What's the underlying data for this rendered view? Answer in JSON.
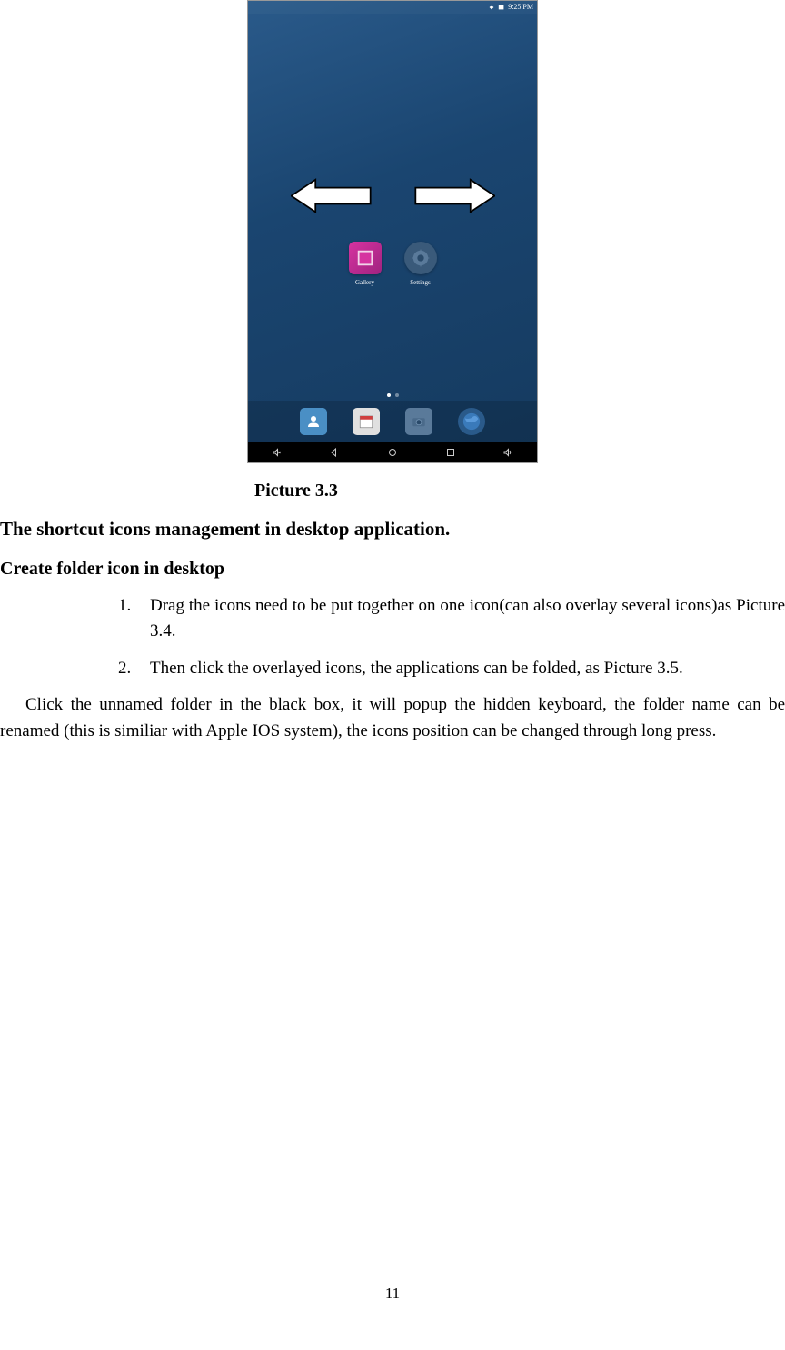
{
  "statusBar": {
    "time": "9:25 PM"
  },
  "apps": {
    "gallery": "Gallery",
    "settings": "Settings"
  },
  "caption": "Picture 3.3",
  "heading1": "The shortcut icons management in desktop application.",
  "heading2": "Create folder icon in desktop",
  "listItem1": "Drag the icons need to be put together on one icon(can also overlay several icons)as Picture 3.4.",
  "listItem2": "Then click the overlayed icons, the applications can be folded, as Picture 3.5.",
  "bodyText": "Click the unnamed folder in the black box, it will popup the hidden keyboard, the folder name can be renamed (this is similiar with Apple IOS system), the icons position can be changed through long press.",
  "pageNumber": "11"
}
